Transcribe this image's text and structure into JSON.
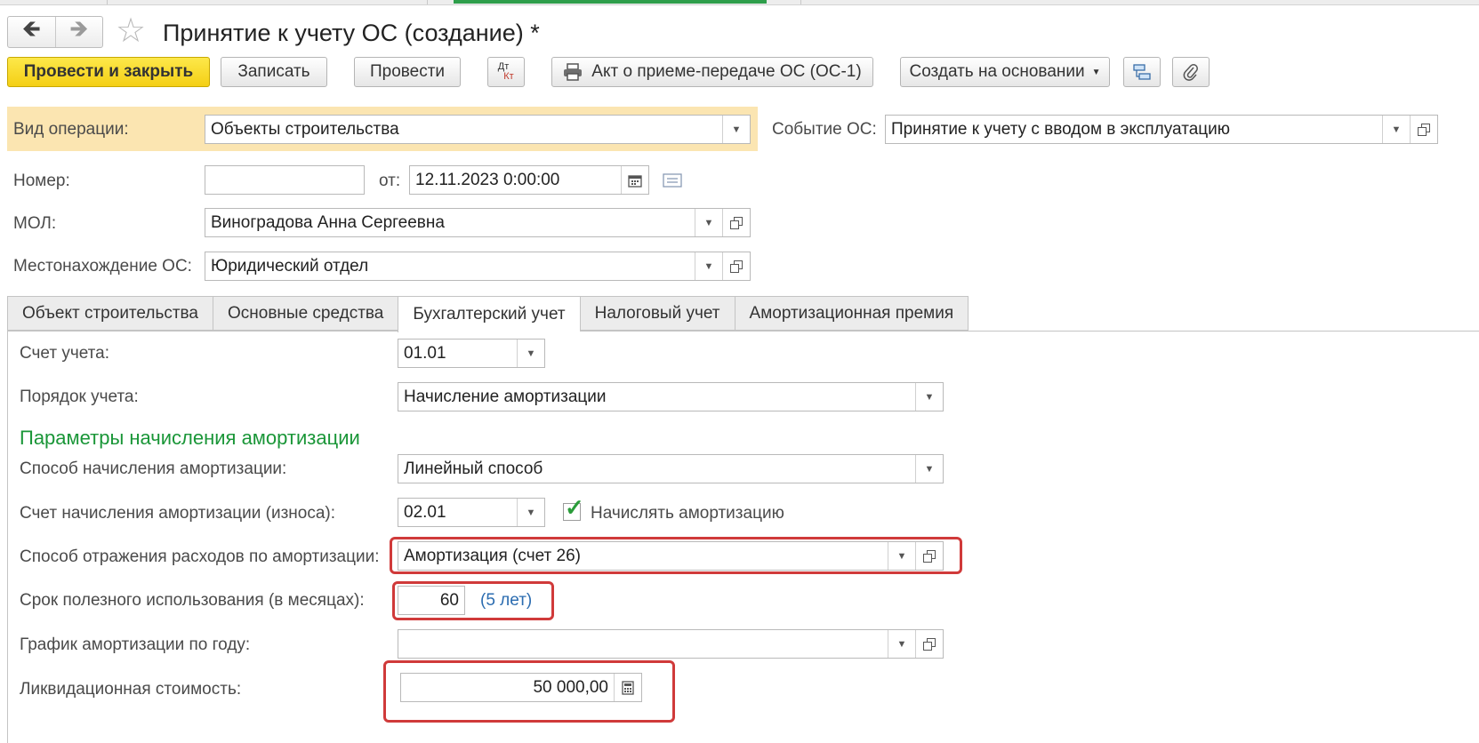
{
  "window": {
    "title": "Принятие к учету ОС (создание) *",
    "nav_back": "back-arrow",
    "nav_forward": "forward-arrow"
  },
  "toolbar": {
    "post_and_close": "Провести и закрыть",
    "save": "Записать",
    "post": "Провести",
    "dtkt_top": "Дт",
    "dtkt_bottom": "Кт",
    "print_act": "Акт о приеме-передаче ОС (ОС-1)",
    "create_based_on": "Создать на основании"
  },
  "header": {
    "operation_type_label": "Вид операции:",
    "operation_type_value": "Объекты строительства",
    "event_label": "Событие ОС:",
    "event_value": "Принятие к учету с вводом в эксплуатацию",
    "number_label": "Номер:",
    "number_value": "",
    "date_from_label": "от:",
    "date_value": "12.11.2023  0:00:00",
    "mol_label": "МОЛ:",
    "mol_value": "Виноградова Анна Сергеевна",
    "location_label": "Местонахождение ОС:",
    "location_value": "Юридический отдел"
  },
  "tabs": [
    {
      "label": "Объект строительства",
      "active": false
    },
    {
      "label": "Основные средства",
      "active": false
    },
    {
      "label": "Бухгалтерский учет",
      "active": true
    },
    {
      "label": "Налоговый учет",
      "active": false
    },
    {
      "label": "Амортизационная премия",
      "active": false
    }
  ],
  "accounting": {
    "account_label": "Счет учета:",
    "account_value": "01.01",
    "procedure_label": "Порядок учета:",
    "procedure_value": "Начисление амортизации",
    "section_title": "Параметры начисления амортизации",
    "method_label": "Способ начисления амортизации:",
    "method_value": "Линейный способ",
    "depr_account_label": "Счет начисления амортизации (износа):",
    "depr_account_value": "02.01",
    "accrue_checkbox_label": "Начислять амортизацию",
    "accrue_checked": true,
    "expense_method_label": "Способ отражения расходов по амортизации:",
    "expense_method_value": "Амортизация (счет 26)",
    "useful_life_label": "Срок полезного использования (в месяцах):",
    "useful_life_value": "60",
    "useful_life_years": "(5 лет)",
    "schedule_label": "График амортизации по году:",
    "schedule_value": "",
    "salvage_label": "Ликвидационная стоимость:",
    "salvage_value": "50 000,00"
  },
  "colors": {
    "primary_button": "#f4cf15",
    "section_title": "#1a9638",
    "highlight_box": "#d03a3a",
    "operation_row_bg": "#fbe5b1",
    "link": "#2b6cb0"
  }
}
